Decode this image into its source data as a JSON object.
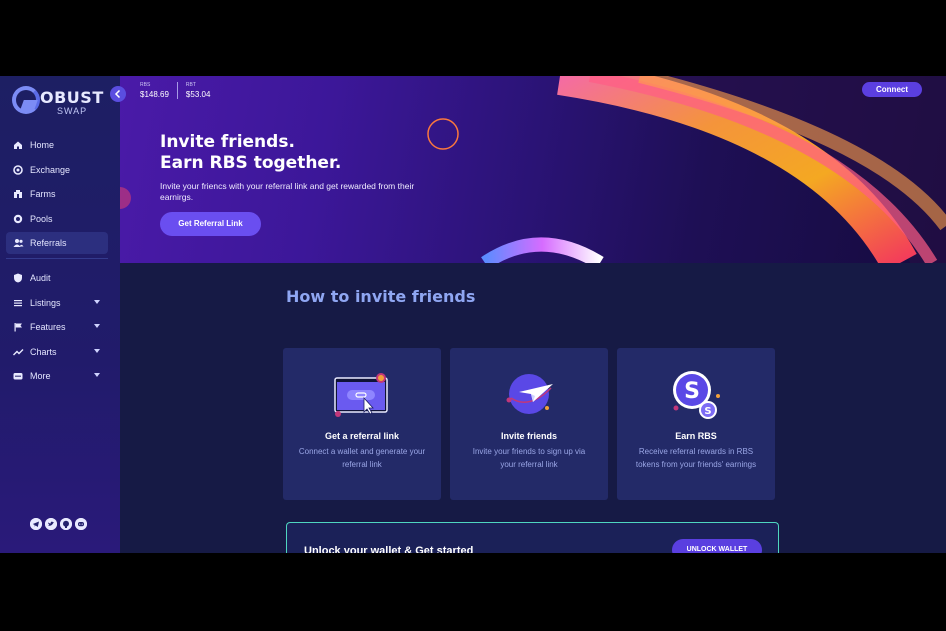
{
  "brand": {
    "logo_text": "OBUST",
    "logo_sub": "SWAP"
  },
  "sidebar": {
    "items": [
      {
        "label": "Home",
        "icon": "home-icon"
      },
      {
        "label": "Exchange",
        "icon": "exchange-icon"
      },
      {
        "label": "Farms",
        "icon": "farm-icon"
      },
      {
        "label": "Pools",
        "icon": "pool-icon"
      },
      {
        "label": "Referrals",
        "icon": "users-icon",
        "active": true
      }
    ],
    "secondary": [
      {
        "label": "Audit",
        "icon": "shield-icon"
      },
      {
        "label": "Listings",
        "icon": "list-icon",
        "has_caret": true
      },
      {
        "label": "Features",
        "icon": "flag-icon",
        "has_caret": true
      },
      {
        "label": "Charts",
        "icon": "chart-icon",
        "has_caret": true
      },
      {
        "label": "More",
        "icon": "more-icon",
        "has_caret": true
      }
    ],
    "socials": [
      "telegram-icon",
      "twitter-icon",
      "github-icon",
      "discord-icon"
    ]
  },
  "header": {
    "prices": [
      {
        "symbol": "RBS",
        "value": "$148.69"
      },
      {
        "symbol": "RBT",
        "value": "$53.04"
      }
    ],
    "connect_label": "Connect"
  },
  "hero": {
    "title_line1": "Invite friends.",
    "title_line2": "Earn RBS together.",
    "description": "Invite your friencs with your referral link and get rewarded from their earnirgs.",
    "cta_label": "Get Referral Link"
  },
  "main": {
    "section_title": "How to invite friends",
    "steps": [
      {
        "title": "Get a referral link",
        "description": "Connect a wallet and generate your referral link"
      },
      {
        "title": "Invite friends",
        "description": "Invite your friends to sign up via your referral link"
      },
      {
        "title": "Earn RBS",
        "description": "Receive referral rewards in RBS tokens from your friends' earnings"
      }
    ],
    "unlock_text": "Unlock your wallet & Get started",
    "unlock_button": "UNLOCK WALLET"
  },
  "colors": {
    "accent": "#5b3fe0",
    "sidebar_bg": "#1d1f63",
    "main_bg": "#161a45",
    "card_bg": "#232a68",
    "section_title": "#8fa6f2",
    "unlock_border": "#4fd6c0"
  }
}
